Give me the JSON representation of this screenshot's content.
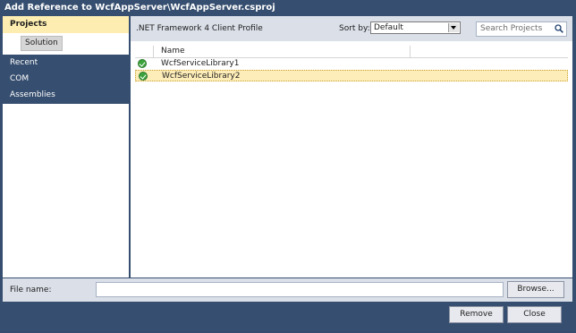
{
  "window": {
    "title": "Add Reference to WcfAppServer\\WcfAppServer.csproj"
  },
  "nav": {
    "section": "Projects",
    "sub_item": "Solution",
    "items": [
      "Recent",
      "COM",
      "Assemblies"
    ]
  },
  "header": {
    "framework": ".NET Framework 4 Client Profile",
    "sort_label": "Sort by:",
    "sort_value": "Default",
    "search_placeholder": "Search Projects"
  },
  "list": {
    "column_name": "Name",
    "rows": [
      {
        "name": "WcfServiceLibrary1",
        "selected": false
      },
      {
        "name": "WcfServiceLibrary2",
        "selected": true
      }
    ]
  },
  "footer": {
    "file_label": "File name:",
    "file_value": "",
    "browse": "Browse...",
    "remove": "Remove",
    "close": "Close"
  },
  "icons": {
    "row_icon": "green-check-circle-icon",
    "search": "magnifier-icon"
  }
}
